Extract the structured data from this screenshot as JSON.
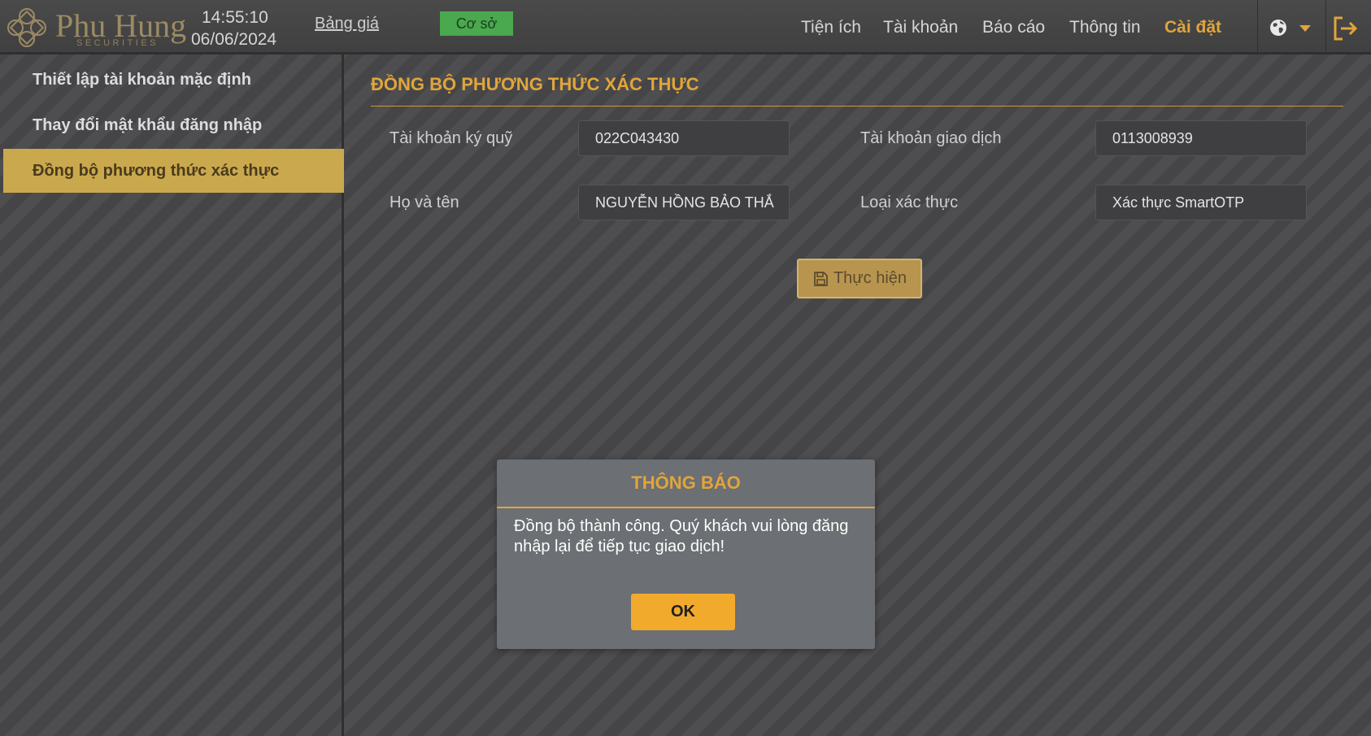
{
  "header": {
    "logo_text": "Phu Hung",
    "logo_sub": "SECURITIES",
    "time": "14:55:10",
    "date": "06/06/2024",
    "price_board_label": "Bảng giá",
    "market_badge_label": "Cơ sở",
    "market_badge_color": "#4aa84e",
    "nav_items": [
      {
        "label": "Tiện ích",
        "active": false
      },
      {
        "label": "Tài khoản",
        "active": false
      },
      {
        "label": "Báo cáo",
        "active": false
      },
      {
        "label": "Thông tin",
        "active": false
      },
      {
        "label": "Cài đặt",
        "active": true
      }
    ],
    "icons": [
      "globe-icon",
      "chevron-down-icon",
      "logout-icon"
    ]
  },
  "sidebar": {
    "items": [
      {
        "label": "Thiết lập tài khoản mặc định",
        "active": false
      },
      {
        "label": "Thay đổi mật khẩu đăng nhập",
        "active": false
      },
      {
        "label": "Đồng bộ phương thức xác thực",
        "active": true
      }
    ]
  },
  "main": {
    "title": "ĐỒNG BỘ PHƯƠNG THỨC XÁC THỰC",
    "fields": {
      "margin_account": {
        "label": "Tài khoản ký quỹ",
        "value": "022C043430"
      },
      "trading_account": {
        "label": "Tài khoản giao dịch",
        "value": "0113008939"
      },
      "full_name": {
        "label": "Họ và tên",
        "value": "NGUYỄN HỒNG BẢO THẮ"
      },
      "auth_type": {
        "label": "Loại xác thực",
        "value": "Xác thực SmartOTP"
      }
    },
    "execute_button": {
      "label": "Thực hiện",
      "icon": "save-icon"
    }
  },
  "modal": {
    "title": "THÔNG BÁO",
    "message": "Đồng bộ thành công. Quý khách vui lòng đăng nhập lại để tiếp tục giao dịch!",
    "ok_label": "OK"
  },
  "colors": {
    "accent": "#e1a53a",
    "sidebar_active": "#caa84e",
    "ok_button": "#f2aa2c"
  }
}
